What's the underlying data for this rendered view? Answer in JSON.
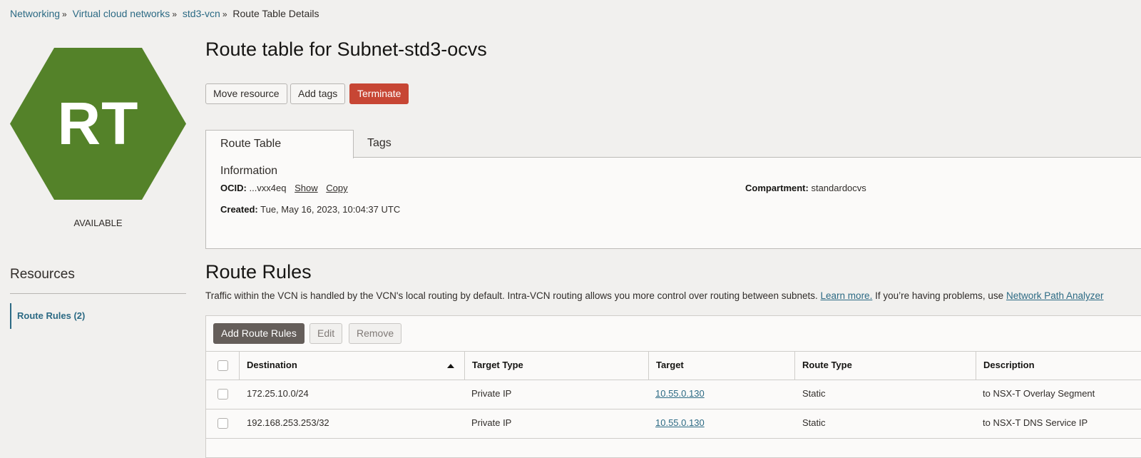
{
  "breadcrumb": {
    "items": [
      "Networking",
      "Virtual cloud networks",
      "std3-vcn"
    ],
    "current": "Route Table Details",
    "separator": "»"
  },
  "resource": {
    "icon_text": "RT",
    "icon_color": "#548229",
    "status": "AVAILABLE"
  },
  "page_title": "Route table for Subnet-std3-ocvs",
  "actions": {
    "move": "Move resource",
    "add_tags": "Add tags",
    "terminate": "Terminate"
  },
  "tabs": [
    "Route Table Information",
    "Tags"
  ],
  "info": {
    "ocid_label": "OCID:",
    "ocid_value": "...vxx4eq",
    "show": "Show",
    "copy": "Copy",
    "created_label": "Created:",
    "created_value": "Tue, May 16, 2023, 10:04:37 UTC",
    "compartment_label": "Compartment:",
    "compartment_value": "standardocvs"
  },
  "sidebar": {
    "title": "Resources",
    "items": [
      {
        "label": "Route Rules (2)"
      }
    ]
  },
  "route_rules": {
    "title": "Route Rules",
    "desc_prefix": "Traffic within the VCN is handled by the VCN's local routing by default. Intra-VCN routing allows you more control over routing between subnets.",
    "learn_more": "Learn more.",
    "desc_mid": "If you’re having problems, use",
    "path_analyzer": "Network Path Analyzer",
    "toolbar": {
      "add": "Add Route Rules",
      "edit": "Edit",
      "remove": "Remove"
    },
    "columns": [
      "Destination",
      "Target Type",
      "Target",
      "Route Type",
      "Description"
    ],
    "sort": {
      "column": "Destination",
      "direction": "ascending"
    },
    "rows": [
      {
        "destination": "172.25.10.0/24",
        "target_type": "Private IP",
        "target": "10.55.0.130",
        "route_type": "Static",
        "description": "to NSX-T Overlay Segment"
      },
      {
        "destination": "192.168.253.253/32",
        "target_type": "Private IP",
        "target": "10.55.0.130",
        "route_type": "Static",
        "description": "to NSX-T DNS Service IP"
      }
    ]
  }
}
